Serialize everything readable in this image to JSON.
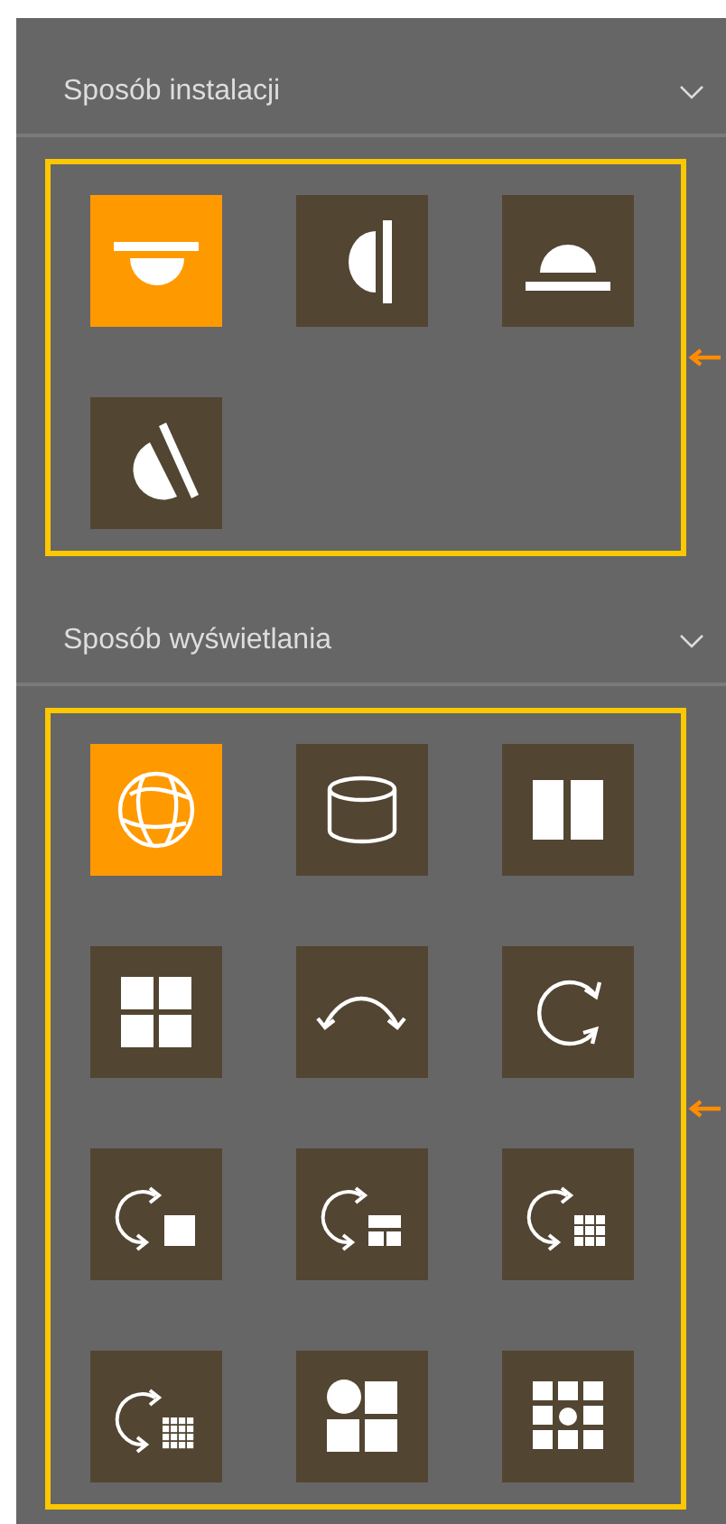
{
  "sections": [
    {
      "title": "Sposób instalacji",
      "items": [
        {
          "kind": "ceiling",
          "selected": true
        },
        {
          "kind": "wall",
          "selected": false
        },
        {
          "kind": "desk",
          "selected": false
        },
        {
          "kind": "slant",
          "selected": false
        }
      ]
    },
    {
      "title": "Sposób wyświetlania",
      "items": [
        {
          "kind": "globe",
          "selected": true
        },
        {
          "kind": "cylinder",
          "selected": false
        },
        {
          "kind": "split",
          "selected": false
        },
        {
          "kind": "quad",
          "selected": false
        },
        {
          "kind": "arc",
          "selected": false
        },
        {
          "kind": "rotate",
          "selected": false
        },
        {
          "kind": "rotate1",
          "selected": false
        },
        {
          "kind": "rotate3",
          "selected": false
        },
        {
          "kind": "rotate9",
          "selected": false
        },
        {
          "kind": "rotate16",
          "selected": false
        },
        {
          "kind": "circlequad",
          "selected": false
        },
        {
          "kind": "grid9",
          "selected": false
        }
      ]
    }
  ]
}
